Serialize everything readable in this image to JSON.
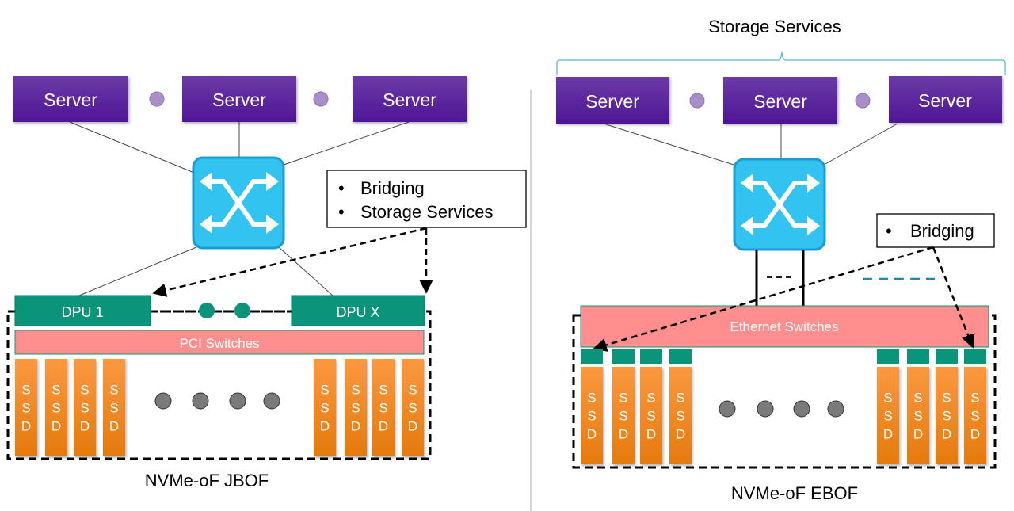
{
  "colors": {
    "server": "#5a1f9e",
    "server_dot": "#a98fc9",
    "switch_fill": "#33c3f0",
    "switch_border": "#1a9bd6",
    "dpu": "#0a957a",
    "dpu_dot": "#0a957a",
    "pci_switch": "#ff8e8e",
    "ssd_top": "#fb9840",
    "ssd_bottom": "#e57a0c",
    "gray_dot": "#7a7a7a",
    "brace": "#5bb7cc",
    "teal_dash": "#1a8cb0"
  },
  "jbof": {
    "title": "NVMe-oF JBOF",
    "servers": [
      "Server",
      "Server",
      "Server"
    ],
    "callout": [
      "Bridging",
      "Storage Services"
    ],
    "callout_bullet": "•",
    "dpus": [
      "DPU 1",
      "DPU X"
    ],
    "pci_label": "PCI Switches",
    "ssd_label": [
      "S",
      "S",
      "D"
    ],
    "ssd_count_left": 4,
    "ssd_count_right": 4,
    "ellipsis_dots": 4
  },
  "ebof": {
    "title": "NVMe-oF EBOF",
    "header": "Storage Services",
    "servers": [
      "Server",
      "Server",
      "Server"
    ],
    "callout": [
      "Bridging"
    ],
    "callout_bullet": "•",
    "eth_label": "Ethernet Switches",
    "ssd_label": [
      "S",
      "S",
      "D"
    ],
    "ssd_count_left": 4,
    "ssd_count_right": 4,
    "ellipsis_dots": 4
  }
}
